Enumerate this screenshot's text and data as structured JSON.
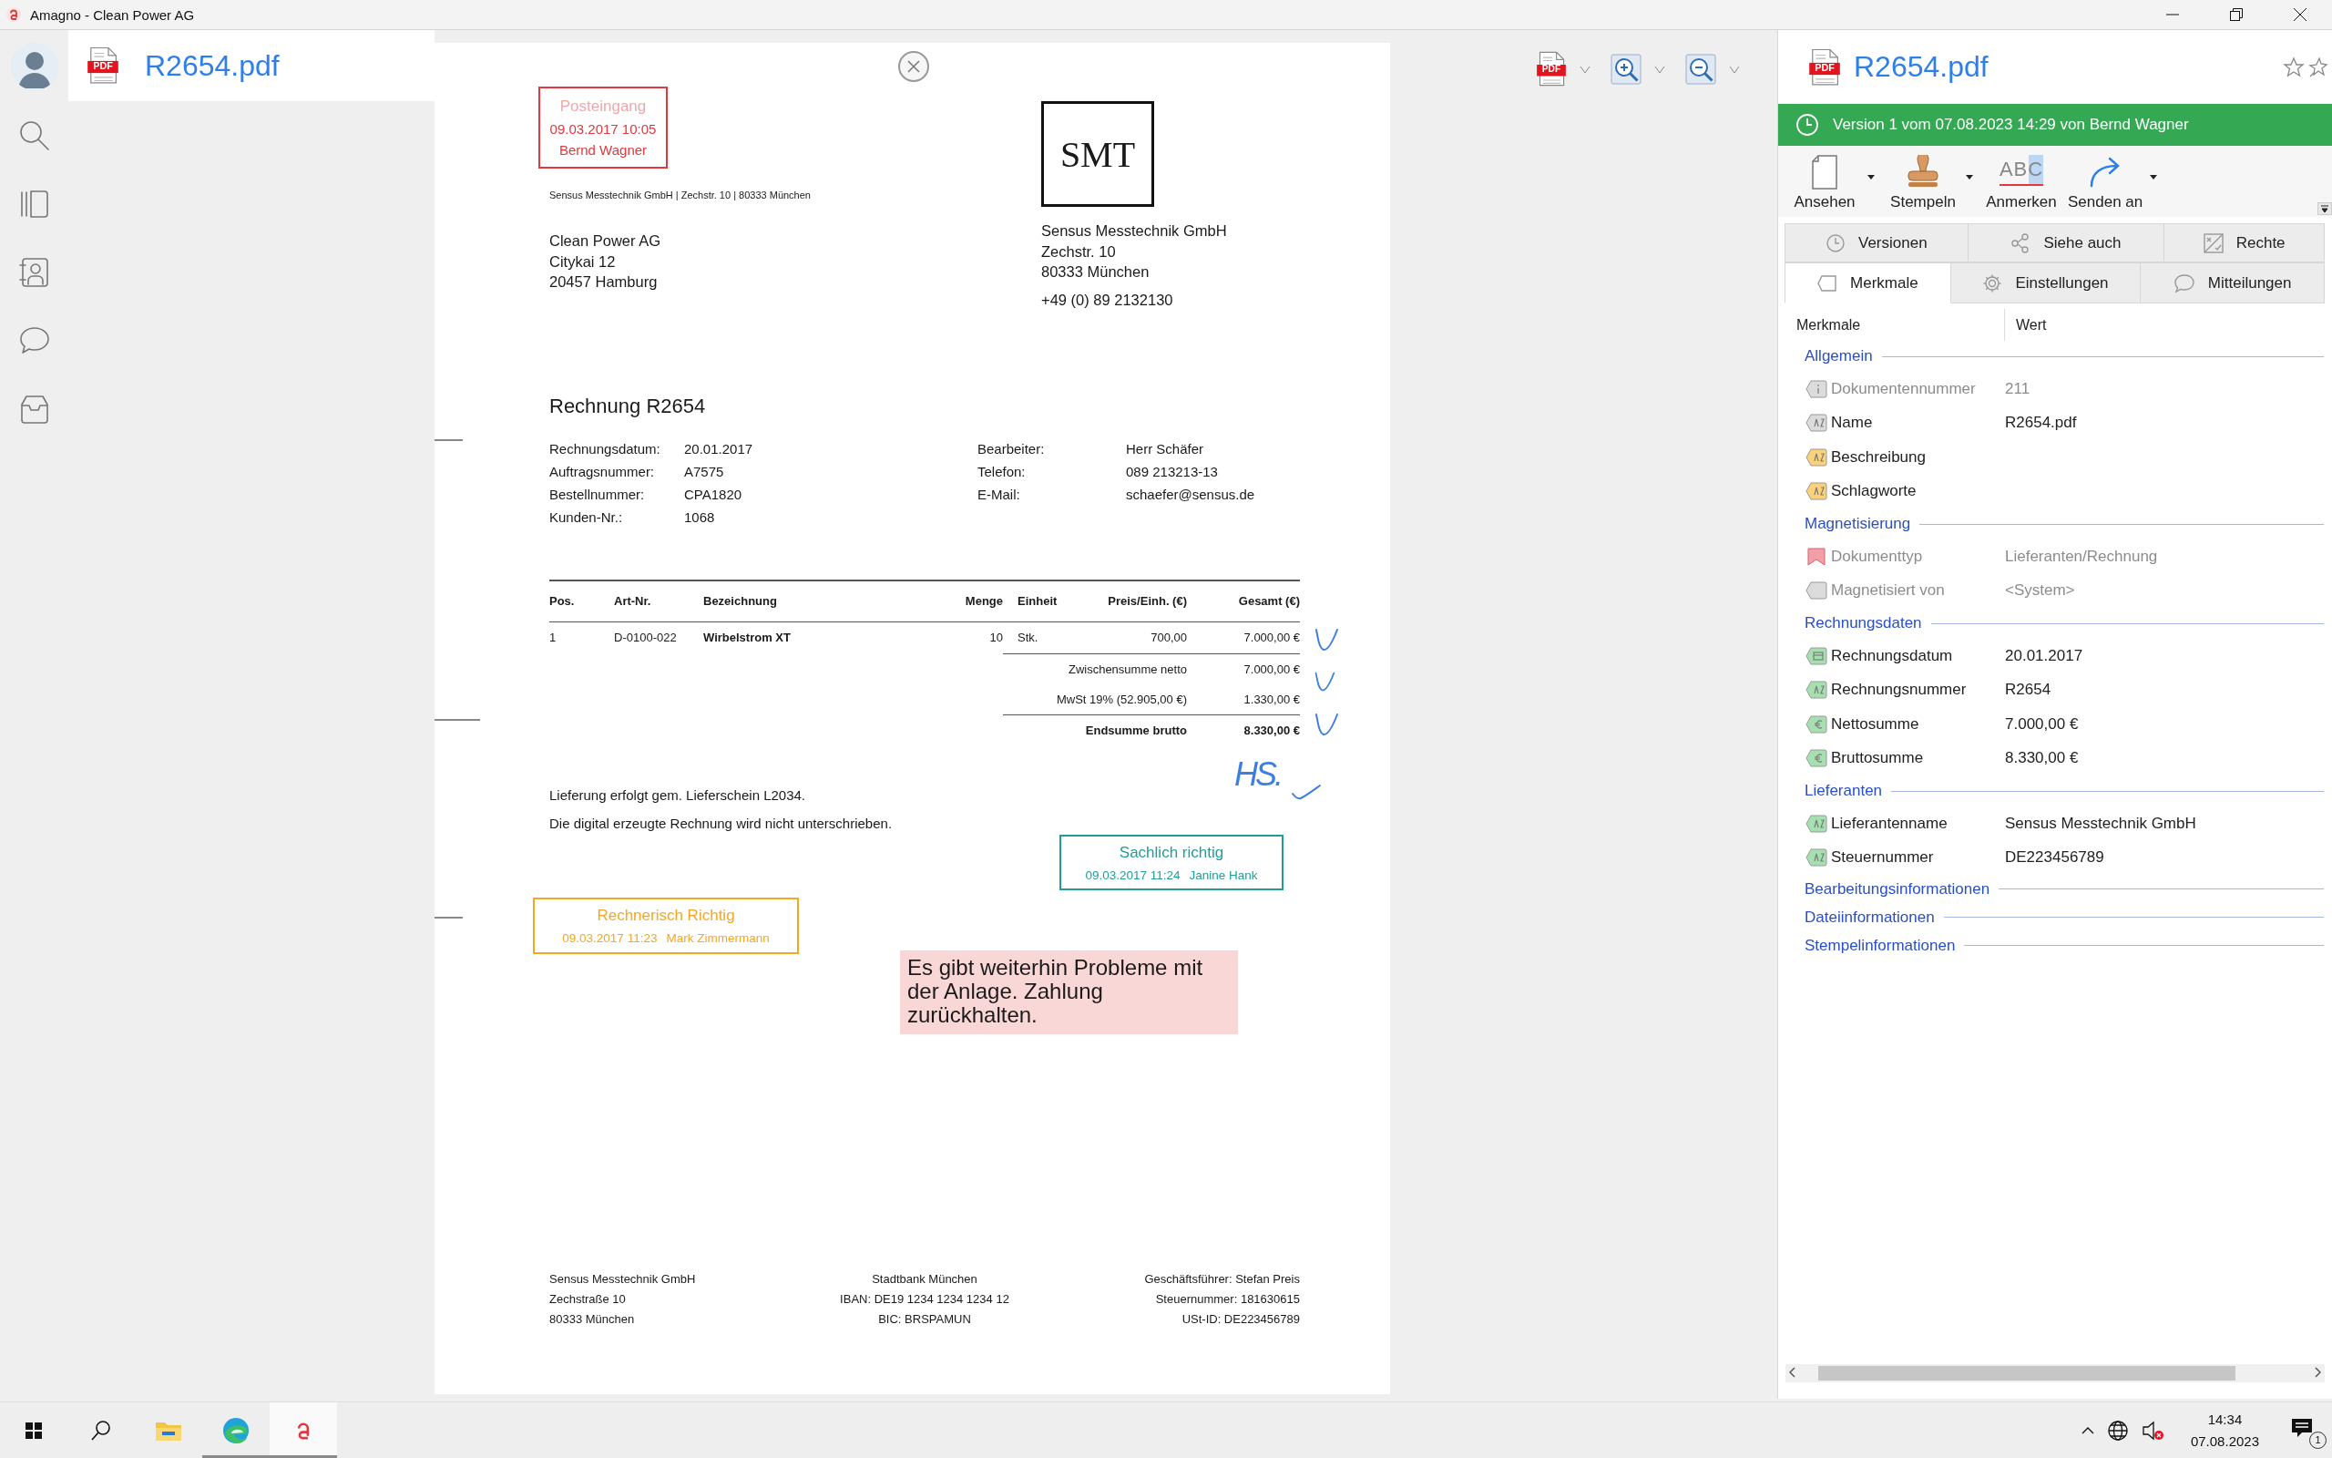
{
  "window": {
    "title": "Amagno - Clean Power AG"
  },
  "viewer": {
    "file_name": "R2654.pdf",
    "file_badge": "PDF",
    "export_badge": "PDF"
  },
  "document": {
    "stamps": [
      {
        "kind": "stacked",
        "title": "Posteingang",
        "date": "09.03.2017 10:05",
        "name": "Bernd Wagner",
        "color": "#e0383e"
      },
      {
        "kind": "inline",
        "title": "Sachlich richtig",
        "date": "09.03.2017 11:24",
        "name": "Janine Hank",
        "color": "#1f9e98"
      },
      {
        "kind": "inline",
        "title": "Rechnerisch Richtig",
        "date": "09.03.2017 11:23",
        "name": "Mark Zimmermann",
        "color": "#f5a623"
      }
    ],
    "sender_line": "Sensus Messtechnik GmbH |  Zechstr. 10 | 80333 München",
    "recipient": [
      "Clean Power AG",
      "Citykai 12",
      "20457 Hamburg"
    ],
    "logo": "SMT",
    "sender": [
      "Sensus Messtechnik GmbH",
      "Zechstr. 10",
      "80333 München"
    ],
    "phone": "+49 (0) 89 2132130",
    "title": "Rechnung R2654",
    "details_left": [
      {
        "label": "Rechnungsdatum:",
        "value": "20.01.2017"
      },
      {
        "label": "Auftragsnummer:",
        "value": "A7575"
      },
      {
        "label": "Bestellnummer:",
        "value": "CPA1820"
      },
      {
        "label": "Kunden-Nr.:",
        "value": "1068"
      }
    ],
    "details_right": [
      {
        "label": "Bearbeiter:",
        "value": "Herr Schäfer"
      },
      {
        "label": "Telefon:",
        "value": "089 213213-13"
      },
      {
        "label": "E-Mail:",
        "value": "schaefer@sensus.de"
      }
    ],
    "table": {
      "columns": [
        "Pos.",
        "Art-Nr.",
        "Bezeichnung",
        "Menge",
        "Einheit",
        "Preis/Einh. (€)",
        "Gesamt (€)"
      ],
      "rows": [
        [
          "1",
          "D-0100-022",
          "Wirbelstrom XT",
          "10",
          "Stk.",
          "700,00",
          "7.000,00 €"
        ]
      ],
      "totals": [
        {
          "label": "Zwischensumme netto",
          "value": "7.000,00 €",
          "kind": "sub"
        },
        {
          "label": "MwSt 19% (52.905,00 €)",
          "value": "1.330,00 €",
          "kind": "tax"
        },
        {
          "label": "Endsumme brutto",
          "value": "8.330,00 €",
          "kind": "total"
        }
      ]
    },
    "notes": [
      "Lieferung erfolgt gem. Lieferschein L2034.",
      "Die digital erzeugte Rechnung wird nicht unterschrieben."
    ],
    "footer": [
      [
        "Sensus Messtechnik GmbH",
        "Zechstraße 10",
        "80333 München"
      ],
      [
        "Stadtbank München",
        "IBAN: DE19 1234 1234 1234 12",
        "BIC: BRSPAMUN"
      ],
      [
        "Geschäftsführer: Stefan Preis",
        "Steuernummer: 181630615",
        "USt-ID: DE223456789"
      ]
    ],
    "comment": "Es gibt weiterhin Probleme mit der Anlage. Zahlung zurückhalten.",
    "handwriting": "HS."
  },
  "panel": {
    "file_name": "R2654.pdf",
    "file_badge": "PDF",
    "version": "Version 1 vom 07.08.2023 14:29 von Bernd Wagner",
    "actions": [
      {
        "label": "Ansehen",
        "kind": "view",
        "menu": true
      },
      {
        "label": "Stempeln",
        "kind": "stamp",
        "menu": true
      },
      {
        "label": "Anmerken",
        "kind": "annotate",
        "menu": false,
        "icon_text": "ABC"
      },
      {
        "label": "Senden an",
        "kind": "send",
        "menu": true
      }
    ],
    "tab_rows": [
      {
        "tabs": [
          {
            "label": "Versionen",
            "kind": "versions",
            "selected": false
          },
          {
            "label": "Siehe auch",
            "kind": "related",
            "selected": false
          },
          {
            "label": "Rechte",
            "kind": "rights",
            "selected": false
          }
        ]
      },
      {
        "tabs": [
          {
            "label": "Merkmale",
            "kind": "properties",
            "selected": true
          },
          {
            "label": "Einstellungen",
            "kind": "settings",
            "selected": false
          },
          {
            "label": "Mitteilungen",
            "kind": "messages",
            "selected": false
          }
        ]
      }
    ],
    "grid": {
      "columns": [
        "Merkmale",
        "Wert"
      ],
      "groups": [
        {
          "title": "Allgemein",
          "rows": [
            {
              "label": "Dokumentennummer",
              "value": "211",
              "kind": "number",
              "color": "#dcdcdc",
              "readonly": true
            },
            {
              "label": "Name",
              "value": "R2654.pdf",
              "kind": "text",
              "color": "#dcdcdc",
              "readonly": false
            },
            {
              "label": "Beschreibung",
              "kind": "text",
              "color": "#fbd27a",
              "readonly": false
            },
            {
              "label": "Schlagworte",
              "kind": "text",
              "color": "#fbd27a",
              "readonly": false
            }
          ]
        },
        {
          "title": "Magnetisierung",
          "rows": [
            {
              "label": "Dokumenttyp",
              "value": "Lieferanten/Rechnung",
              "kind": "doctype",
              "color": "#f2a0a8",
              "readonly": true
            },
            {
              "label": "Magnetisiert von",
              "value": "<System>",
              "kind": "system",
              "color": "#dcdcdc",
              "readonly": true
            }
          ]
        },
        {
          "title": "Rechnungsdaten",
          "rows": [
            {
              "label": "Rechnungsdatum",
              "value": "20.01.2017",
              "kind": "date",
              "color": "#a6e0b0",
              "readonly": false
            },
            {
              "label": "Rechnungsnummer",
              "value": "R2654",
              "kind": "text",
              "color": "#a6e0b0",
              "readonly": false
            },
            {
              "label": "Nettosumme",
              "value": "7.000,00 €",
              "kind": "currency",
              "color": "#a6e0b0",
              "readonly": false
            },
            {
              "label": "Bruttosumme",
              "value": "8.330,00 €",
              "kind": "currency",
              "color": "#a6e0b0",
              "readonly": false
            }
          ]
        },
        {
          "title": "Lieferanten",
          "rows": [
            {
              "label": "Lieferantenname",
              "value": "Sensus Messtechnik GmbH",
              "kind": "text",
              "color": "#a6e0b0",
              "readonly": false
            },
            {
              "label": "Steuernummer",
              "value": "DE223456789",
              "kind": "text",
              "color": "#a6e0b0",
              "readonly": false
            }
          ]
        },
        {
          "title": "Bearbeitungsinformationen"
        },
        {
          "title": "Dateiinformationen"
        },
        {
          "title": "Stempelinformationen"
        }
      ]
    }
  },
  "taskbar": {
    "apps": [
      {
        "kind": "files",
        "selected": false,
        "running": false
      },
      {
        "kind": "browser",
        "selected": false,
        "running": true
      },
      {
        "kind": "amagno",
        "selected": true,
        "running": true
      }
    ],
    "time": "14:34",
    "date": "07.08.2023",
    "notification_count": "1"
  }
}
